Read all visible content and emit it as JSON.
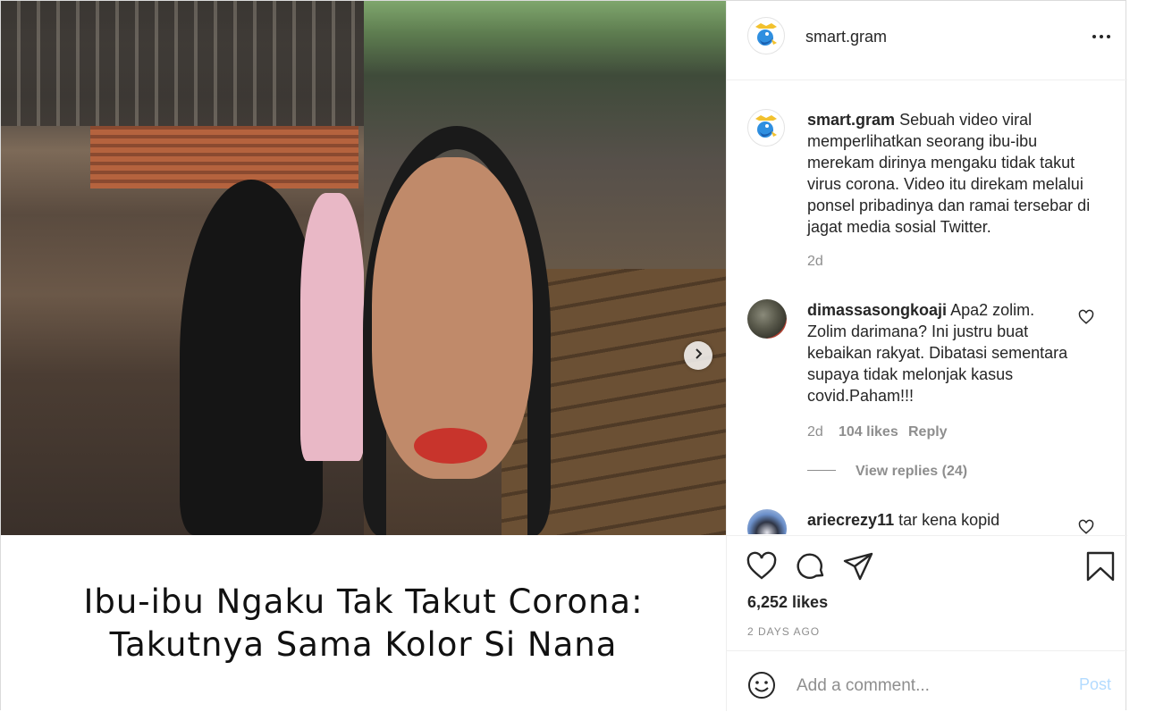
{
  "header": {
    "username": "smart.gram",
    "more_icon": "more-horizontal-icon"
  },
  "media": {
    "caption_line1": "Ibu-ibu Ngaku Tak Takut Corona:",
    "caption_line2": "Takutnya Sama Kolor Si Nana",
    "next_icon": "chevron-right-icon"
  },
  "caption": {
    "username": "smart.gram",
    "text": "Sebuah video viral memperlihatkan seorang ibu-ibu merekam dirinya mengaku tidak takut virus corona. Video itu direkam melalui ponsel pribadinya dan ramai tersebar di jagat media sosial Twitter.",
    "time": "2d"
  },
  "comments": [
    {
      "username": "dimassasongkoaji",
      "text": "Apa2 zolim. Zolim darimana? Ini justru buat kebaikan rakyat. Dibatasi sementara supaya tidak melonjak kasus covid.Paham!!!",
      "time": "2d",
      "likes": "104 likes",
      "reply": "Reply",
      "view_replies": "View replies (24)"
    },
    {
      "username": "ariecrezy11",
      "text": "tar kena kopid"
    }
  ],
  "actions": {
    "likes": "6,252 likes",
    "time_ago": "2 DAYS AGO"
  },
  "add_comment": {
    "placeholder": "Add a comment...",
    "post_label": "Post"
  },
  "colors": {
    "post_button": "#b3dbff",
    "text": "#262626",
    "muted": "#8e8e8e"
  }
}
